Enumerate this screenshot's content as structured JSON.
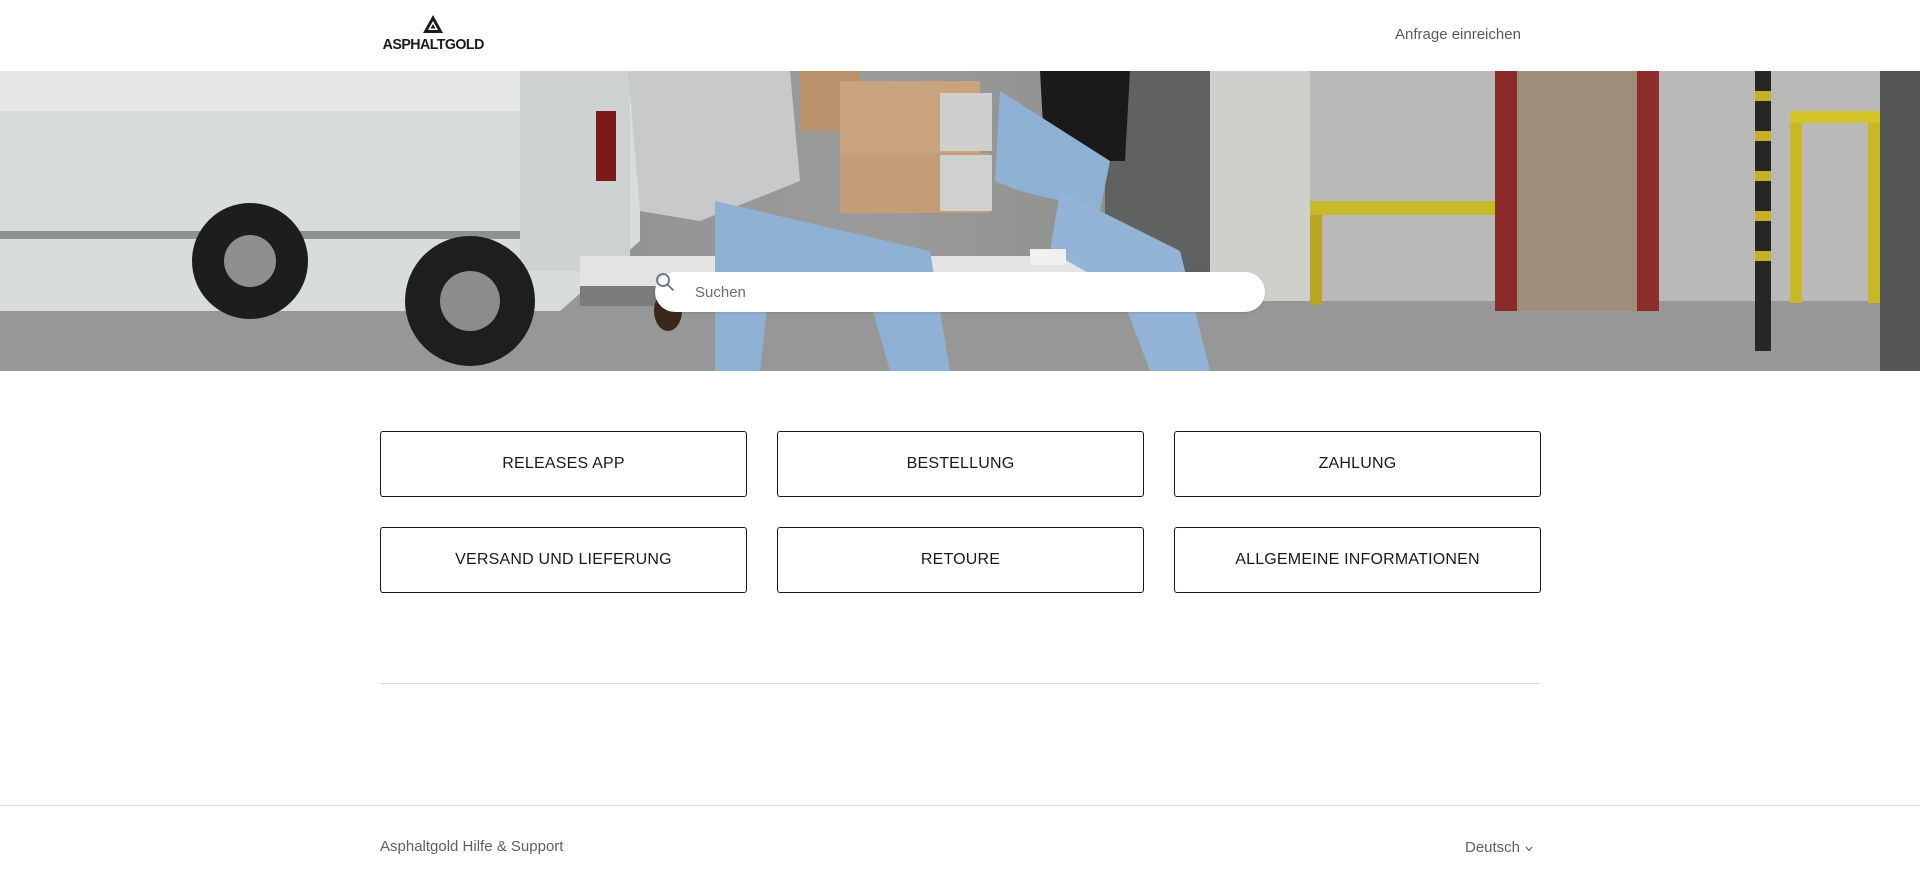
{
  "header": {
    "logo_text": "ASPHALTGOLD",
    "submit_request": "Anfrage einreichen"
  },
  "search": {
    "placeholder": "Suchen"
  },
  "categories": [
    {
      "label": "RELEASES APP"
    },
    {
      "label": "BESTELLUNG"
    },
    {
      "label": "ZAHLUNG"
    },
    {
      "label": "VERSAND UND LIEFERUNG"
    },
    {
      "label": "RETOURE"
    },
    {
      "label": "ALLGEMEINE INFORMATIONEN"
    }
  ],
  "footer": {
    "title": "Asphaltgold Hilfe & Support",
    "language": "Deutsch"
  },
  "colors": {
    "border": "#1a1a1a",
    "divider": "#dcdfe2",
    "muted_text": "#5c6166"
  }
}
